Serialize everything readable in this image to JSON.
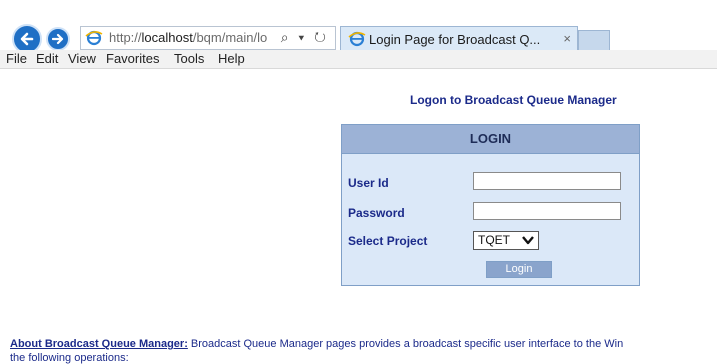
{
  "browser": {
    "url_prefix": "http://",
    "url_host": "localhost",
    "url_path": "/bqm/main/lo",
    "url_controls": "⌕ ▾ ↻",
    "tab_title": "Login Page for Broadcast Q...",
    "tab_close": "×"
  },
  "menubar": [
    "File",
    "Edit",
    "View",
    "Favorites",
    "Tools",
    "Help"
  ],
  "page": {
    "title": "Logon to Broadcast Queue Manager",
    "panel_header": "LOGIN",
    "user_id_label": "User Id",
    "password_label": "Password",
    "project_label": "Select Project",
    "project_value": "TQET",
    "login_button": "Login",
    "user_id_value": "",
    "password_value": ""
  },
  "about": {
    "link": "About Broadcast Queue Manager:",
    "text": " Broadcast Queue Manager pages provides a broadcast specific user interface to the Win",
    "line2": "the following operations:"
  },
  "colors": {
    "accent": "#1f6fc5",
    "panel_bg": "#dbe8f8",
    "panel_header": "#9cb2d6",
    "label": "#1b2a8a",
    "button": "#8aa4cc"
  },
  "icons": [
    "back-arrow-icon",
    "forward-arrow-icon",
    "ie-logo-icon",
    "search-icon",
    "dropdown-icon",
    "refresh-icon",
    "close-icon",
    "chevron-down-icon"
  ]
}
